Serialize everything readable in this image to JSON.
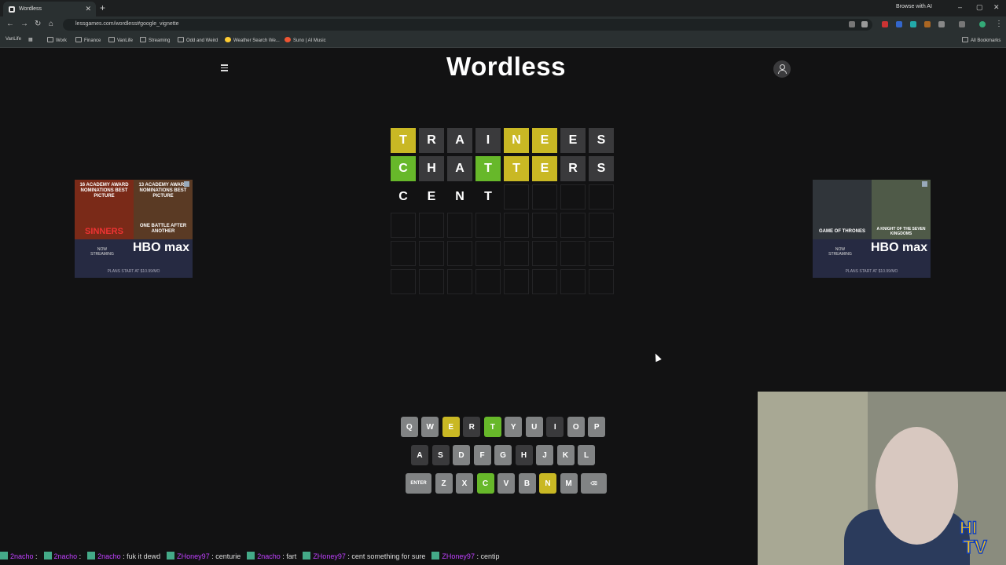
{
  "browser": {
    "tab_title": "Wordless",
    "url": "lessgames.com/wordless#google_vignette",
    "browse_ai_label": "Browse with AI",
    "bookmarks": [
      "VanLife",
      "Work",
      "Finance",
      "VanLife",
      "Streaming",
      "Odd and Weird",
      "Weather Search We...",
      "Suno | AI Music"
    ],
    "all_bookmarks_label": "All Bookmarks"
  },
  "game": {
    "title": "Wordless",
    "board": [
      [
        [
          "T",
          "present"
        ],
        [
          "R",
          "absent"
        ],
        [
          "A",
          "absent"
        ],
        [
          "I",
          "absent"
        ],
        [
          "N",
          "present"
        ],
        [
          "E",
          "present"
        ],
        [
          "E",
          "absent"
        ],
        [
          "S",
          "absent"
        ]
      ],
      [
        [
          "C",
          "correct"
        ],
        [
          "H",
          "absent"
        ],
        [
          "A",
          "absent"
        ],
        [
          "T",
          "correct"
        ],
        [
          "T",
          "present"
        ],
        [
          "E",
          "present"
        ],
        [
          "R",
          "absent"
        ],
        [
          "S",
          "absent"
        ]
      ],
      [
        [
          "C",
          "typed"
        ],
        [
          "E",
          "typed"
        ],
        [
          "N",
          "typed"
        ],
        [
          "T",
          "typed"
        ],
        [
          "",
          "empty"
        ],
        [
          "",
          "empty"
        ],
        [
          "",
          "empty"
        ],
        [
          "",
          "empty"
        ]
      ],
      [
        [
          "",
          "empty"
        ],
        [
          "",
          "empty"
        ],
        [
          "",
          "empty"
        ],
        [
          "",
          "empty"
        ],
        [
          "",
          "empty"
        ],
        [
          "",
          "empty"
        ],
        [
          "",
          "empty"
        ],
        [
          "",
          "empty"
        ]
      ],
      [
        [
          "",
          "empty"
        ],
        [
          "",
          "empty"
        ],
        [
          "",
          "empty"
        ],
        [
          "",
          "empty"
        ],
        [
          "",
          "empty"
        ],
        [
          "",
          "empty"
        ],
        [
          "",
          "empty"
        ],
        [
          "",
          "empty"
        ]
      ],
      [
        [
          "",
          "empty"
        ],
        [
          "",
          "empty"
        ],
        [
          "",
          "empty"
        ],
        [
          "",
          "empty"
        ],
        [
          "",
          "empty"
        ],
        [
          "",
          "empty"
        ],
        [
          "",
          "empty"
        ],
        [
          "",
          "empty"
        ]
      ]
    ],
    "keyboard": [
      [
        [
          "Q",
          ""
        ],
        [
          "W",
          ""
        ],
        [
          "E",
          "present"
        ],
        [
          "R",
          "absent"
        ],
        [
          "T",
          "correct"
        ],
        [
          "Y",
          ""
        ],
        [
          "U",
          ""
        ],
        [
          "I",
          "absent"
        ],
        [
          "O",
          ""
        ],
        [
          "P",
          ""
        ]
      ],
      [
        [
          "A",
          "absent"
        ],
        [
          "S",
          "absent"
        ],
        [
          "D",
          ""
        ],
        [
          "F",
          ""
        ],
        [
          "G",
          ""
        ],
        [
          "H",
          "absent"
        ],
        [
          "J",
          ""
        ],
        [
          "K",
          ""
        ],
        [
          "L",
          ""
        ]
      ],
      [
        [
          "ENTER",
          "wide"
        ],
        [
          "Z",
          ""
        ],
        [
          "X",
          ""
        ],
        [
          "C",
          "correct"
        ],
        [
          "V",
          ""
        ],
        [
          "B",
          ""
        ],
        [
          "N",
          "present"
        ],
        [
          "M",
          ""
        ],
        [
          "⌫",
          "wide"
        ]
      ]
    ]
  },
  "ads": {
    "left": {
      "headline_1": "16 ACADEMY AWARD NOMINATIONS BEST PICTURE",
      "movie_1": "SINNERS",
      "headline_2": "13 ACADEMY AWARD NOMINATIONS BEST PICTURE",
      "movie_2": "ONE BATTLE AFTER ANOTHER",
      "now_streaming": "NOW STREAMING",
      "brand": "HBO max",
      "plans": "PLANS START AT $10.99/MO"
    },
    "right": {
      "show_1": "GAME OF THRONES",
      "show_2": "A KNIGHT OF THE SEVEN KINGDOMS",
      "now_streaming": "NOW STREAMING",
      "brand": "HBO max",
      "plans": "PLANS START AT $10.99/MO"
    }
  },
  "stream_chat": [
    {
      "name": "2nacho",
      "msg": ""
    },
    {
      "name": "2nacho",
      "msg": ""
    },
    {
      "name": "2nacho",
      "msg": "fuk it dewd"
    },
    {
      "name": "ZHoney97",
      "msg": "centurie"
    },
    {
      "name": "2nacho",
      "msg": "fart"
    },
    {
      "name": "ZHoney97",
      "msg": "cent something for sure"
    },
    {
      "name": "ZHoney97",
      "msg": "centip"
    }
  ],
  "overlay_logo": {
    "line1": "HI",
    "line2": "TV"
  }
}
